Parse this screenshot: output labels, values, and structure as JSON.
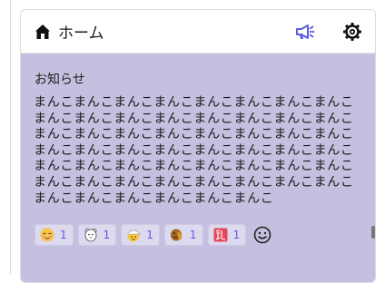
{
  "header": {
    "title": "ホーム",
    "icons": [
      "home-icon",
      "megaphone-icon",
      "gear-icon"
    ],
    "accent": "#5b5be0"
  },
  "note": {
    "title": "お知らせ",
    "body": "まんこまんこまんこまんこまんこまんこまんこまんこまんこまんこまんこまんこまんこまんこまんこまんこまんこまんこまんこまんこまんこまんこまんこまんこまんこまんこまんこまんこまんこまんこまんこまんこまんこまんこまんこまんこまんこまんこまんこまんこまんこまんこまんこまんこまんこまんこまんこまんこまんこまんこまんこまんこまんこまんこ",
    "background": "#c5c0df"
  },
  "reactions": [
    {
      "icon": "relieved-face-icon",
      "count": "1"
    },
    {
      "icon": "bear-sticker-icon",
      "count": "1"
    },
    {
      "icon": "face-with-cap-icon",
      "count": "1"
    },
    {
      "icon": "hands-emoji-icon",
      "count": "1"
    },
    {
      "icon": "milk-kanji-icon",
      "count": "1"
    }
  ],
  "add_reaction_icon": "smile-plus-icon"
}
